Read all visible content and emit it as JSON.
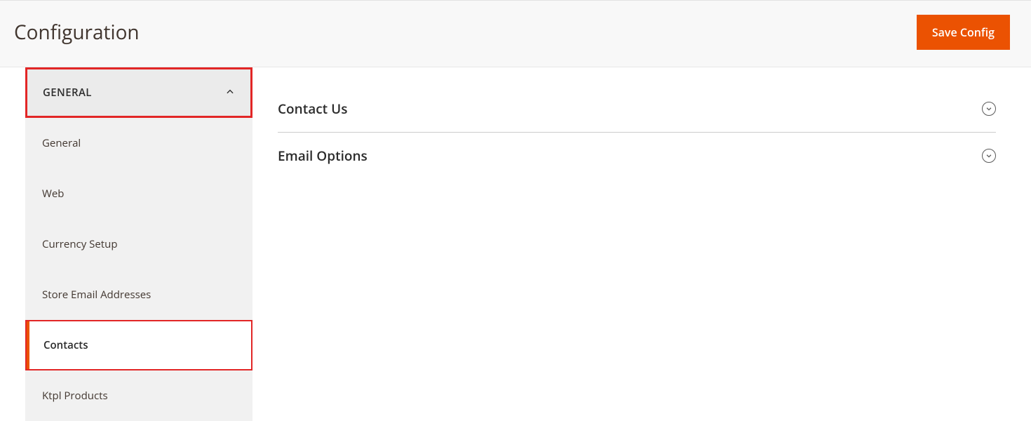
{
  "header": {
    "title": "Configuration",
    "save_label": "Save Config"
  },
  "sidebar": {
    "section_label": "GENERAL",
    "items": [
      {
        "label": "General"
      },
      {
        "label": "Web"
      },
      {
        "label": "Currency Setup"
      },
      {
        "label": "Store Email Addresses"
      },
      {
        "label": "Contacts"
      },
      {
        "label": "Ktpl Products"
      }
    ]
  },
  "main": {
    "sections": [
      {
        "title": "Contact Us"
      },
      {
        "title": "Email Options"
      }
    ]
  }
}
